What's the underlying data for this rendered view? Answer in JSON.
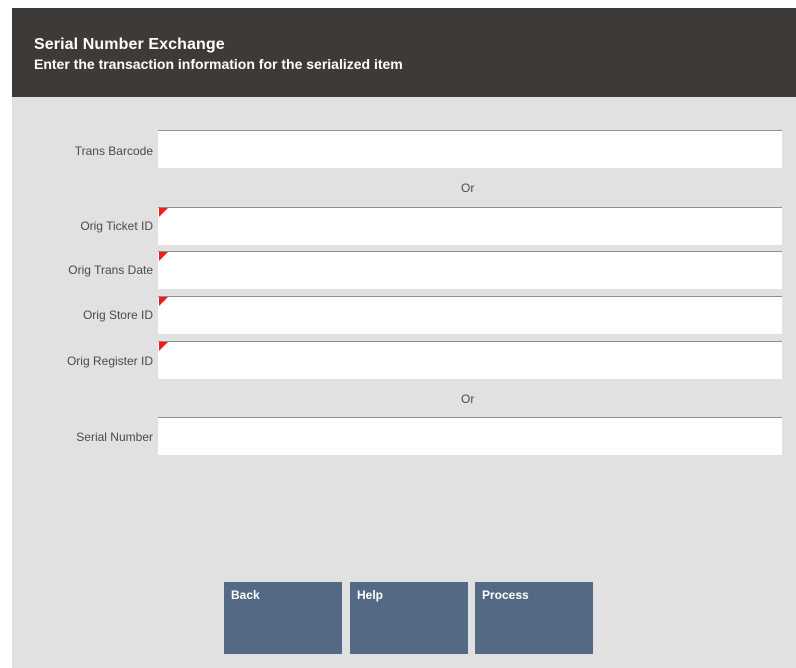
{
  "header": {
    "title": "Serial Number Exchange",
    "subtitle": "Enter the transaction information for the serialized item"
  },
  "form": {
    "trans_barcode": {
      "label": "Trans Barcode",
      "value": "",
      "required": false
    },
    "or_1": "Or",
    "orig_ticket_id": {
      "label": "Orig Ticket ID",
      "value": "",
      "required": true
    },
    "orig_trans_date": {
      "label": "Orig Trans Date",
      "value": "",
      "required": true
    },
    "orig_store_id": {
      "label": "Orig Store ID",
      "value": "",
      "required": true
    },
    "orig_register_id": {
      "label": "Orig Register ID",
      "value": "",
      "required": true
    },
    "or_2": "Or",
    "serial_number": {
      "label": "Serial Number",
      "value": "",
      "required": false
    }
  },
  "buttons": {
    "back": "Back",
    "help": "Help",
    "process": "Process"
  },
  "colors": {
    "header_bg": "#3e3a37",
    "panel_bg": "#e1e1e1",
    "button_bg": "#546a84",
    "required_marker": "#ee1c1c"
  }
}
